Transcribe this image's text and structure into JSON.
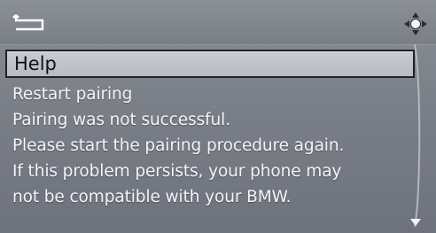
{
  "header": {
    "back_icon": "back-arrow-icon",
    "nav_icon": "controller-dpad-icon"
  },
  "menu": {
    "selected_item": "Help"
  },
  "message": {
    "lines": [
      "Restart pairing",
      "Pairing was not successful.",
      "Please start the pairing procedure again.",
      "If this problem persists, your phone may",
      "not be compatible with your BMW."
    ]
  },
  "scroll": {
    "icon": "scroll-down-arrow-icon"
  },
  "colors": {
    "background": "#7a7f88",
    "highlight": "#c4c7cc",
    "text": "#f4f4f6"
  }
}
